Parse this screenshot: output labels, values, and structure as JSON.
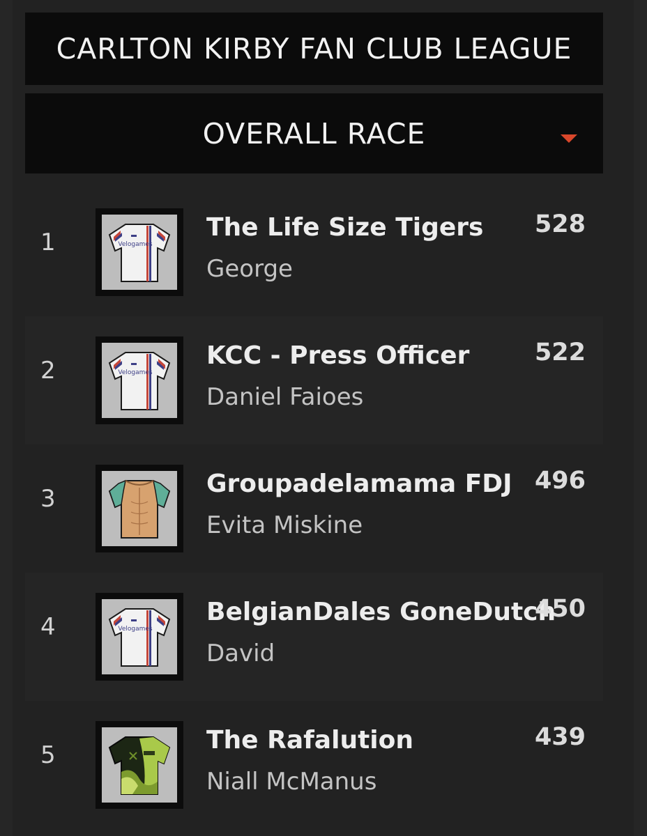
{
  "league": {
    "title": "CARLTON KIRBY FAN CLUB LEAGUE"
  },
  "race_selector": {
    "selected": "OVERALL RACE",
    "caret_color": "#d9472b"
  },
  "standings": [
    {
      "rank": "1",
      "team": "The Life Size Tigers",
      "manager": "George",
      "points": "528",
      "jersey": "velogames-default-jersey-icon",
      "jersey_text": "Velogames"
    },
    {
      "rank": "2",
      "team": "KCC - Press Officer",
      "manager": "Daniel Faioes",
      "points": "522",
      "jersey": "velogames-default-jersey-icon",
      "jersey_text": "Velogames"
    },
    {
      "rank": "3",
      "team": "Groupadelamama FDJ",
      "manager": "Evita Miskine",
      "points": "496",
      "jersey": "torso-jersey-icon"
    },
    {
      "rank": "4",
      "team": "BelgianDales GoneDutch",
      "manager": "David",
      "points": "450",
      "jersey": "velogames-default-jersey-icon",
      "jersey_text": "Velogames"
    },
    {
      "rank": "5",
      "team": "The Rafalution",
      "manager": "Niall McManus",
      "points": "439",
      "jersey": "green-black-jersey-icon"
    }
  ]
}
